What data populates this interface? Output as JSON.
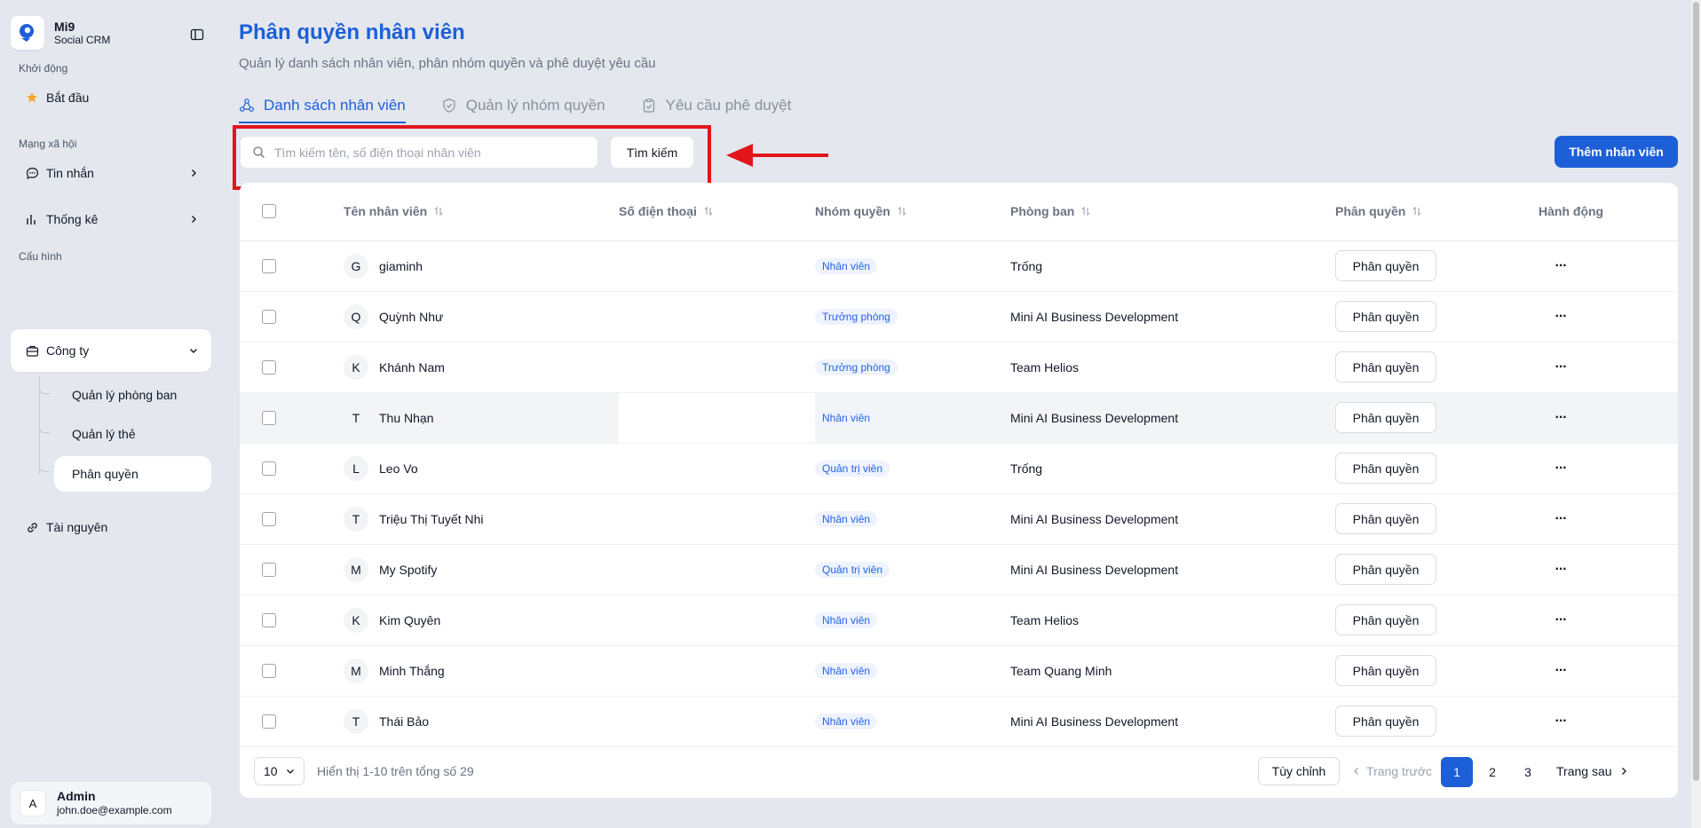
{
  "brand": {
    "name": "Mi9",
    "subtitle": "Social CRM"
  },
  "sidebar": {
    "sections": [
      {
        "label": "Khởi động"
      },
      {
        "label": "Mạng xã hội"
      },
      {
        "label": "Cấu hình"
      }
    ],
    "items": [
      {
        "label": "Bắt đầu",
        "icon": "star-icon"
      },
      {
        "label": "Tin nhắn",
        "icon": "message-icon"
      },
      {
        "label": "Thống kê",
        "icon": "chart-icon"
      },
      {
        "label": "Công ty",
        "icon": "briefcase-icon"
      },
      {
        "label": "Tài nguyên",
        "icon": "link-icon"
      }
    ],
    "sub_items": [
      {
        "label": "Quản lý phòng ban"
      },
      {
        "label": "Quản lý thẻ"
      },
      {
        "label": "Phân quyền"
      }
    ],
    "user": {
      "initial": "A",
      "name": "Admin",
      "email": "john.doe@example.com"
    }
  },
  "page": {
    "title": "Phân quyền nhân viên",
    "subtitle": "Quản lý danh sách nhân viên, phân nhóm quyền và phê duyệt yêu cầu"
  },
  "tabs": [
    {
      "label": "Danh sách nhân viên",
      "active": true
    },
    {
      "label": "Quản lý nhóm quyền",
      "active": false
    },
    {
      "label": "Yêu cầu phê duyệt",
      "active": false
    }
  ],
  "search": {
    "placeholder": "Tìm kiếm tên, số điện thoại nhân viên",
    "value": "",
    "button_label": "Tìm kiếm"
  },
  "add_button_label": "Thêm nhân viên",
  "table": {
    "headers": {
      "name": "Tên nhân viên",
      "phone": "Số điện thoại",
      "group": "Nhóm quyền",
      "department": "Phòng ban",
      "permission": "Phân quyền",
      "action": "Hành động"
    },
    "permission_button_label": "Phân quyền",
    "more_label": "···",
    "rows": [
      {
        "initial": "G",
        "name": "giaminh",
        "phone": "",
        "group": "Nhân viên",
        "department": "Trống"
      },
      {
        "initial": "Q",
        "name": "Quỳnh Như",
        "phone": "",
        "group": "Trưởng phòng",
        "department": "Mini AI Business Development"
      },
      {
        "initial": "K",
        "name": "Khánh Nam",
        "phone": "",
        "group": "Trưởng phòng",
        "department": "Team Helios"
      },
      {
        "initial": "T",
        "name": "Thu Nhạn",
        "phone": "",
        "group": "Nhân viên",
        "department": "Mini AI Business Development"
      },
      {
        "initial": "L",
        "name": "Leo Vo",
        "phone": "",
        "group": "Quản trị viên",
        "department": "Trống"
      },
      {
        "initial": "T",
        "name": "Triệu Thị Tuyết Nhi",
        "phone": "",
        "group": "Nhân viên",
        "department": "Mini AI Business Development"
      },
      {
        "initial": "M",
        "name": "My Spotify",
        "phone": "",
        "group": "Quản trị viên",
        "department": "Mini AI Business Development"
      },
      {
        "initial": "K",
        "name": "Kim Quyên",
        "phone": "",
        "group": "Nhân viên",
        "department": "Team Helios"
      },
      {
        "initial": "M",
        "name": "Minh Thắng",
        "phone": "",
        "group": "Nhân viên",
        "department": "Team Quang Minh"
      },
      {
        "initial": "T",
        "name": "Thái Bảo",
        "phone": "",
        "group": "Nhân viên",
        "department": "Mini AI Business Development"
      }
    ]
  },
  "pagination": {
    "page_size": "10",
    "info": "Hiển thị 1-10 trên tổng số 29",
    "custom_label": "Tùy chỉnh",
    "prev_label": "Trang trước",
    "next_label": "Trang sau",
    "pages": [
      "1",
      "2",
      "3"
    ],
    "current": "1"
  },
  "colors": {
    "primary": "#1d5fd6",
    "highlight": "#e1161b",
    "badge_bg": "#eef3fd"
  }
}
